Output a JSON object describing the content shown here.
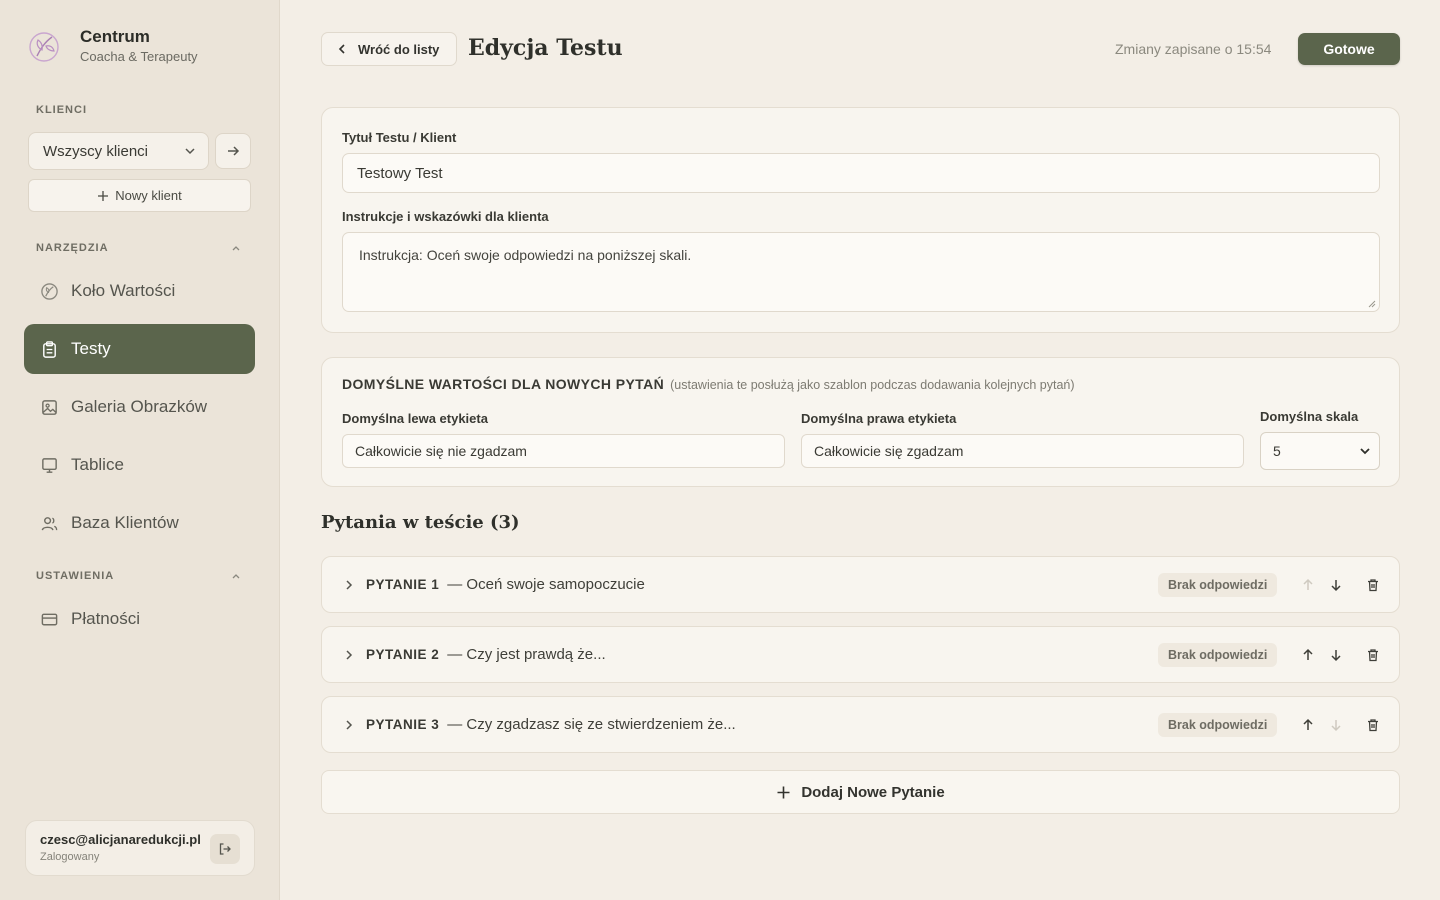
{
  "brand": {
    "name": "Centrum",
    "subtitle": "Coacha & Terapeuty"
  },
  "sidebar": {
    "clients_label": "KLIENCI",
    "client_select_value": "Wszyscy klienci",
    "new_client_label": "Nowy klient",
    "tools_label": "NARZĘDZIA",
    "tools": [
      {
        "label": "Koło Wartości",
        "icon": "wheel-icon"
      },
      {
        "label": "Testy",
        "icon": "clipboard-icon",
        "active": true
      },
      {
        "label": "Galeria Obrazków",
        "icon": "image-icon"
      },
      {
        "label": "Tablice",
        "icon": "board-icon"
      },
      {
        "label": "Baza Klientów",
        "icon": "users-icon"
      }
    ],
    "settings_label": "USTAWIENIA",
    "settings": [
      {
        "label": "Płatności",
        "icon": "card-icon"
      }
    ],
    "user": {
      "email": "czesc@alicjanaredukcji.pl",
      "status": "Zalogowany"
    }
  },
  "header": {
    "back_label": "Wróć do listy",
    "title": "Edycja Testu",
    "save_status": "Zmiany zapisane o 15:54",
    "done_label": "Gotowe"
  },
  "test_form": {
    "title_label": "Tytuł Testu / Klient",
    "title_value": "Testowy Test",
    "instructions_label": "Instrukcje i wskazówki dla klienta",
    "instructions_value": "Instrukcja: Oceń swoje odpowiedzi na poniższej skali."
  },
  "defaults": {
    "title": "DOMYŚLNE WARTOŚCI DLA NOWYCH PYTAŃ",
    "note": "(ustawienia te posłużą jako szablon podczas dodawania kolejnych pytań)",
    "left_label": "Domyślna lewa etykieta",
    "left_value": "Całkowicie się nie zgadzam",
    "right_label": "Domyślna prawa etykieta",
    "right_value": "Całkowicie się zgadzam",
    "scale_label": "Domyślna skala",
    "scale_value": "5"
  },
  "questions": {
    "title": "Pytania w teście (3)",
    "items": [
      {
        "number": "PYTANIE 1",
        "text": "— Oceń swoje samopoczucie",
        "badge": "Brak odpowiedzi",
        "up_disabled": true,
        "down_disabled": false
      },
      {
        "number": "PYTANIE 2",
        "text": "— Czy jest prawdą że...",
        "badge": "Brak odpowiedzi",
        "up_disabled": false,
        "down_disabled": false
      },
      {
        "number": "PYTANIE 3",
        "text": "— Czy zgadzasz się ze stwierdzeniem że...",
        "badge": "Brak odpowiedzi",
        "up_disabled": false,
        "down_disabled": true
      }
    ],
    "add_label": "Dodaj Nowe Pytanie"
  },
  "colors": {
    "accent": "#5b654c",
    "background": "#f3eee6",
    "sidebar": "#ebe4d9"
  }
}
